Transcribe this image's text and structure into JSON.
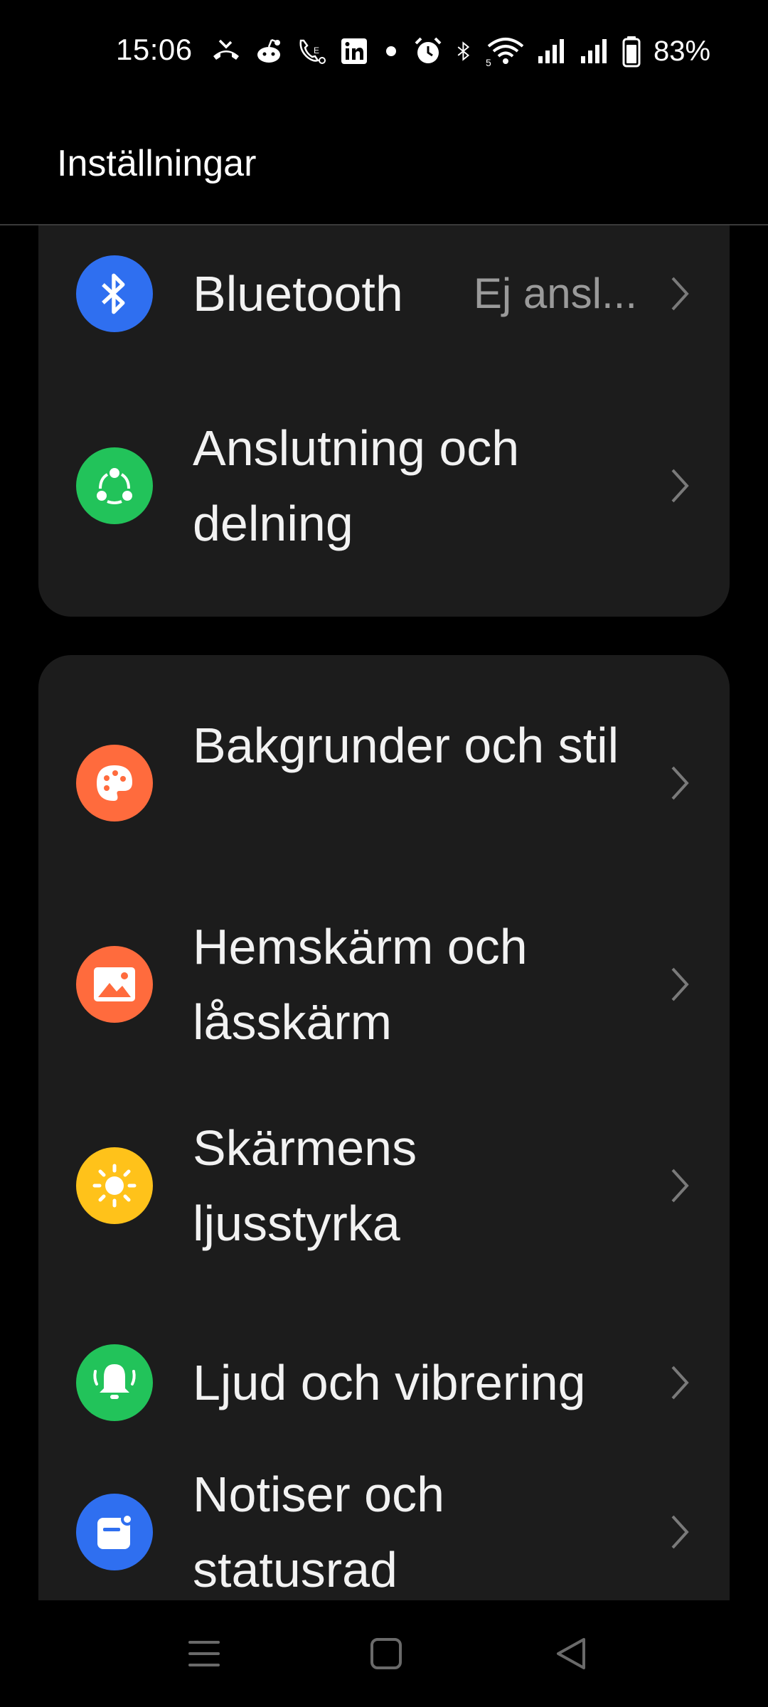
{
  "status_bar": {
    "time": "15:06",
    "icons": [
      "missed-call-icon",
      "reddit-icon",
      "call-forward-icon",
      "linkedin-icon",
      "dot-icon",
      "alarm-icon",
      "bluetooth-icon",
      "wifi-icon",
      "signal-icon",
      "signal-icon",
      "battery-icon"
    ],
    "wifi_badge": "5",
    "battery": "83%"
  },
  "app_bar": {
    "title": "Inställningar"
  },
  "group1": {
    "items": [
      {
        "label": "Bluetooth",
        "value": "Ej ansl...",
        "icon": "bluetooth-icon",
        "color": "#2f6ff0"
      },
      {
        "label": "Anslutning och delning",
        "icon": "share-connection-icon",
        "color": "#22c35a"
      }
    ]
  },
  "group2": {
    "items": [
      {
        "label": "Bakgrunder och stil",
        "icon": "palette-icon",
        "color": "#ff6b3d"
      },
      {
        "label": "Hemskärm och låsskärm",
        "icon": "image-icon",
        "color": "#ff6b3d"
      },
      {
        "label": "Skärmens ljusstyrka",
        "icon": "sun-icon",
        "color": "#ffc21a"
      },
      {
        "label": "Ljud och vibrering",
        "icon": "bell-icon",
        "color": "#22c35a"
      },
      {
        "label": "Notiser och statusrad",
        "icon": "notification-icon",
        "color": "#2f6ff0"
      }
    ]
  },
  "nav_bar": {
    "items": [
      "menu-icon",
      "home-icon",
      "back-icon"
    ]
  }
}
